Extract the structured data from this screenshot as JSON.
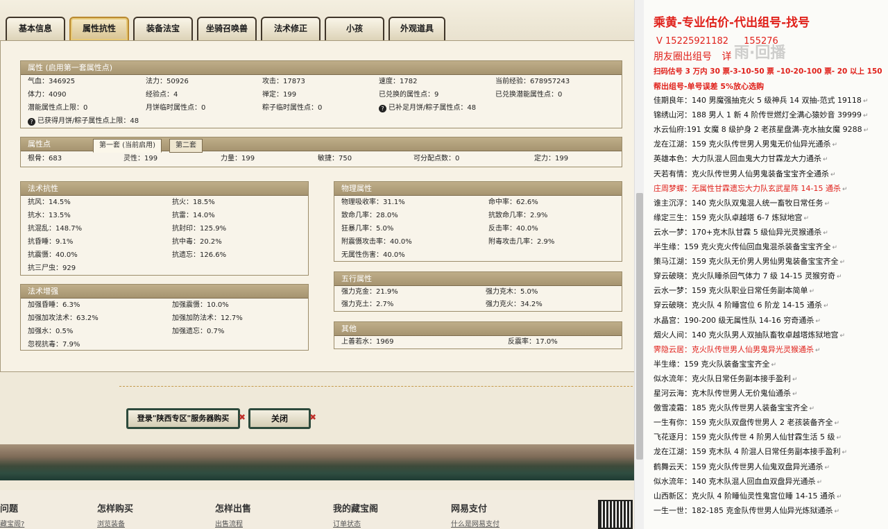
{
  "tabs": [
    "基本信息",
    "属性抗性",
    "装备法宝",
    "坐骑召唤兽",
    "法术修正",
    "小孩",
    "外观道具"
  ],
  "active_tab": 1,
  "attr_panel": {
    "title": "属性 (启用第一套属性点)",
    "rows": [
      [
        "气血：346925",
        "法力：50926",
        "攻击：17873",
        "速度：1782",
        "当前经验：678957243"
      ],
      [
        "体力：4090",
        "经验点：4",
        "禅定：199",
        "已兑换的属性点：9",
        "已兑换潜能属性点：0"
      ],
      [
        "潜能属性点上限：0",
        "月饼临时属性点：0",
        "粽子临时属性点：0",
        "已补足月饼/粽子属性点：48",
        ""
      ],
      [
        "已获得月饼/粽子属性点上限：48",
        "",
        "",
        "",
        ""
      ]
    ]
  },
  "points_panel": {
    "title": "属性点",
    "tab1": "第一套 (当前启用)",
    "tab2": "第二套",
    "row": [
      "根骨：683",
      "灵性：199",
      "力量：199",
      "敏捷：750",
      "可分配点数：0",
      "定力：199"
    ]
  },
  "magic_resist": {
    "title": "法术抗性",
    "rows": [
      [
        "抗风：14.5%",
        "抗火：18.5%"
      ],
      [
        "抗水：13.5%",
        "抗雷：14.0%"
      ],
      [
        "抗混乱：148.7%",
        "抗封印：125.9%"
      ],
      [
        "抗昏睡：9.1%",
        "抗中毒：20.2%"
      ],
      [
        "抗震慑：40.0%",
        "抗遗忘：126.6%"
      ],
      [
        "抗三尸虫：929",
        ""
      ]
    ]
  },
  "physical": {
    "title": "物理属性",
    "rows": [
      [
        "物理吸收率：31.1%",
        "命中率：62.6%"
      ],
      [
        "致命几率：28.0%",
        "抗致命几率：2.9%"
      ],
      [
        "狂暴几率：5.0%",
        "反击率：40.0%"
      ],
      [
        "附震慑攻击率：40.0%",
        "附毒攻击几率：2.9%"
      ],
      [
        "无属性伤害：40.0%",
        ""
      ]
    ]
  },
  "magic_boost": {
    "title": "法术增强",
    "rows": [
      [
        "加强昏睡：6.3%",
        "加强震慑：10.0%"
      ],
      [
        "加强加攻法术：63.2%",
        "加强加防法术：12.7%"
      ],
      [
        "加强水：0.5%",
        "加强遗忘：0.7%"
      ],
      [
        "忽视抗毒：7.9%",
        ""
      ]
    ]
  },
  "five_elements": {
    "title": "五行属性",
    "rows": [
      [
        "强力克金：21.9%",
        "强力克木：5.0%"
      ],
      [
        "强力克土：2.7%",
        "强力克火：34.2%"
      ]
    ]
  },
  "other": {
    "title": "其他",
    "rows": [
      [
        "上善若水：1969",
        "反震率：17.0%"
      ]
    ]
  },
  "buttons": {
    "buy": "登录\"陕西专区\"服务器购买",
    "close": "关闭"
  },
  "footer": {
    "heads": [
      "问题",
      "怎样购买",
      "怎样出售",
      "我的藏宝阁",
      "网易支付"
    ],
    "links": [
      "藏宝阁?",
      "浏览装备",
      "出售流程",
      "订单状态",
      "什么是网易支付"
    ]
  },
  "right": {
    "title": "乘黄-专业估价-代出组号-找号",
    "phone": "V 15225921182",
    "phone2": "155276",
    "circle": "朋友圈出组号",
    "circle2": "详",
    "watermark": "雨·回播",
    "line_price": "扫码估号 3 万内 30 票-3-10-50 票 –10-20-100 票- 20 以上 150",
    "line_help": "帮出组号-单号误差 5%放心选购",
    "entries": [
      {
        "t": "佳期良年：140 男魔强抽克火 5 级神兵 14 双抽-范式 19118",
        "red": false
      },
      {
        "t": "锦绣山河：188 男人 1 新 4 阶传世燃灯全满心猿妙音 39999",
        "red": false
      },
      {
        "t": "水云仙府:191 女魔 8 级护身 2 老孩星盘满-克水抽女魔 9288",
        "red": false
      },
      {
        "t": "龙在江湖：159 克火队传世男人男鬼无价仙异光通杀",
        "red": false
      },
      {
        "t": "英雄本色：大力队混人回血鬼大力甘霖龙大力通杀",
        "red": false
      },
      {
        "t": "天若有情：克火队传世男人仙男鬼装备宝宝齐全通杀",
        "red": false
      },
      {
        "t": "庄周梦蝶：无属性甘霖遗忘大力队玄武星阵 14-15 通杀",
        "red": true
      },
      {
        "t": "谁主沉浮：140 克火队双鬼混人统一畜牧日常任务",
        "red": false
      },
      {
        "t": "缘定三生：159 克火队卓越塔 6-7 炼狱地宫",
        "red": false
      },
      {
        "t": "云水一梦：170+克木队甘霖 5 级仙异光灵猴通杀",
        "red": false
      },
      {
        "t": "半生缘：159 克火克火传仙回血鬼混杀装备宝宝齐全",
        "red": false
      },
      {
        "t": "策马江湖：159 克火队无价男人男仙男鬼装备宝宝齐全",
        "red": false
      },
      {
        "t": "穿云破晓：克火队睡杀回气体力 7 级 14-15 灵猴穷奇",
        "red": false
      },
      {
        "t": "云水一梦：159 克火队职业日常任务副本简单",
        "red": false
      },
      {
        "t": "穿云破晓：克火队 4 阶睡宫位 6 阶龙 14-15 通杀",
        "red": false
      },
      {
        "t": "水晶宫：190-200 级无属性队 14-16 穷奇通杀",
        "red": false
      },
      {
        "t": "烟火人间：140 克火队男人双抽队畜牧卓越塔炼狱地宫",
        "red": false
      },
      {
        "t": "霁隐云居：克火队传世男人仙男鬼异光灵猴通杀",
        "red": true
      },
      {
        "t": "半生缘：159 克火队装备宝宝齐全",
        "red": false
      },
      {
        "t": "似水流年：克火队日常任务副本接手盈利",
        "red": false
      },
      {
        "t": "星河云海：克木队传世男人无价鬼仙通杀",
        "red": false
      },
      {
        "t": "傲雪凌霜：185 克火队传世男人装备宝宝齐全",
        "red": false
      },
      {
        "t": "一生有你：159 克火队双盘传世男人 2 老孩装备齐全",
        "red": false
      },
      {
        "t": "飞花逐月：159 克火队传世 4 阶男人仙甘霖生活 5 级",
        "red": false
      },
      {
        "t": "龙在江湖：159 克木队 4 阶混人日常任务副本接手盈利",
        "red": false
      },
      {
        "t": "鹤舞云天：159 克火队传世男人仙鬼双盘异光通杀",
        "red": false
      },
      {
        "t": "似水流年：140 克木队混人回血血双盘异光通杀",
        "red": false
      },
      {
        "t": "山西新区：克火队 4 阶睡仙灵性鬼宫位睡 14-15 通杀",
        "red": false
      },
      {
        "t": "一生一世：182-185 克金队传世男人仙异光炼狱通杀",
        "red": false
      }
    ]
  }
}
